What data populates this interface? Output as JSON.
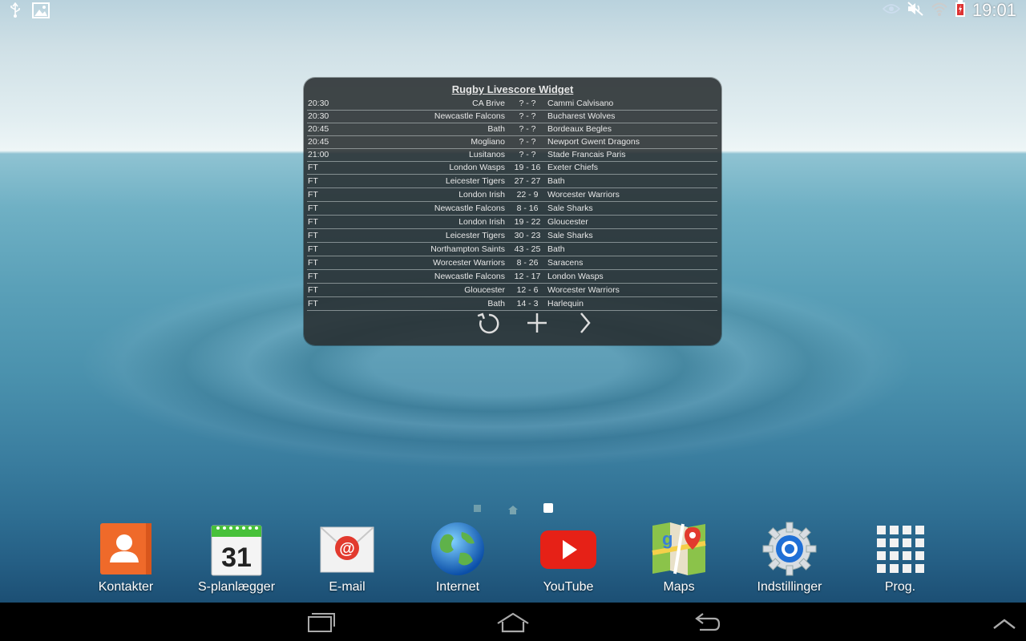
{
  "status_bar": {
    "left_icons": [
      "usb-icon",
      "image-icon"
    ],
    "right_icons": [
      "smart-stay-eye-icon",
      "mute-icon",
      "wifi-icon",
      "battery-charging-icon"
    ],
    "time": "19:01"
  },
  "widget": {
    "title": "Rugby Livescore Widget",
    "matches": [
      {
        "time": "20:30",
        "home": "CA Brive",
        "score": "? - ?",
        "away": "Cammi Calvisano"
      },
      {
        "time": "20:30",
        "home": "Newcastle Falcons",
        "score": "? - ?",
        "away": "Bucharest Wolves"
      },
      {
        "time": "20:45",
        "home": "Bath",
        "score": "? - ?",
        "away": "Bordeaux Begles"
      },
      {
        "time": "20:45",
        "home": "Mogliano",
        "score": "? - ?",
        "away": "Newport Gwent Dragons"
      },
      {
        "time": "21:00",
        "home": "Lusitanos",
        "score": "? - ?",
        "away": "Stade Francais Paris"
      },
      {
        "time": "FT",
        "home": "London Wasps",
        "score": "19 - 16",
        "away": "Exeter Chiefs"
      },
      {
        "time": "FT",
        "home": "Leicester Tigers",
        "score": "27 - 27",
        "away": "Bath"
      },
      {
        "time": "FT",
        "home": "London Irish",
        "score": "22 - 9",
        "away": "Worcester Warriors"
      },
      {
        "time": "FT",
        "home": "Newcastle Falcons",
        "score": "8 - 16",
        "away": "Sale Sharks"
      },
      {
        "time": "FT",
        "home": "London Irish",
        "score": "19 - 22",
        "away": "Gloucester"
      },
      {
        "time": "FT",
        "home": "Leicester Tigers",
        "score": "30 - 23",
        "away": "Sale Sharks"
      },
      {
        "time": "FT",
        "home": "Northampton Saints",
        "score": "43 - 25",
        "away": "Bath"
      },
      {
        "time": "FT",
        "home": "Worcester Warriors",
        "score": "8 - 26",
        "away": "Saracens"
      },
      {
        "time": "FT",
        "home": "Newcastle Falcons",
        "score": "12 - 17",
        "away": "London Wasps"
      },
      {
        "time": "FT",
        "home": "Gloucester",
        "score": "12 - 6",
        "away": "Worcester Warriors"
      },
      {
        "time": "FT",
        "home": "Bath",
        "score": "14 - 3",
        "away": "Harlequin"
      }
    ],
    "controls": [
      "refresh-icon",
      "add-icon",
      "next-icon"
    ]
  },
  "home_pages": {
    "count": 3,
    "current": 3
  },
  "dock": {
    "apps": [
      {
        "label": "Kontakter",
        "icon": "contacts-icon"
      },
      {
        "label": "S-planlægger",
        "icon": "calendar-icon",
        "calendar_day": "31"
      },
      {
        "label": "E-mail",
        "icon": "email-icon"
      },
      {
        "label": "Internet",
        "icon": "globe-icon"
      },
      {
        "label": "YouTube",
        "icon": "youtube-icon"
      },
      {
        "label": "Maps",
        "icon": "maps-icon"
      },
      {
        "label": "Indstillinger",
        "icon": "settings-gear-icon"
      },
      {
        "label": "Prog.",
        "icon": "apps-grid-icon"
      }
    ]
  },
  "nav_bar": [
    "recent-apps-icon",
    "home-icon",
    "back-icon",
    "expand-icon"
  ]
}
